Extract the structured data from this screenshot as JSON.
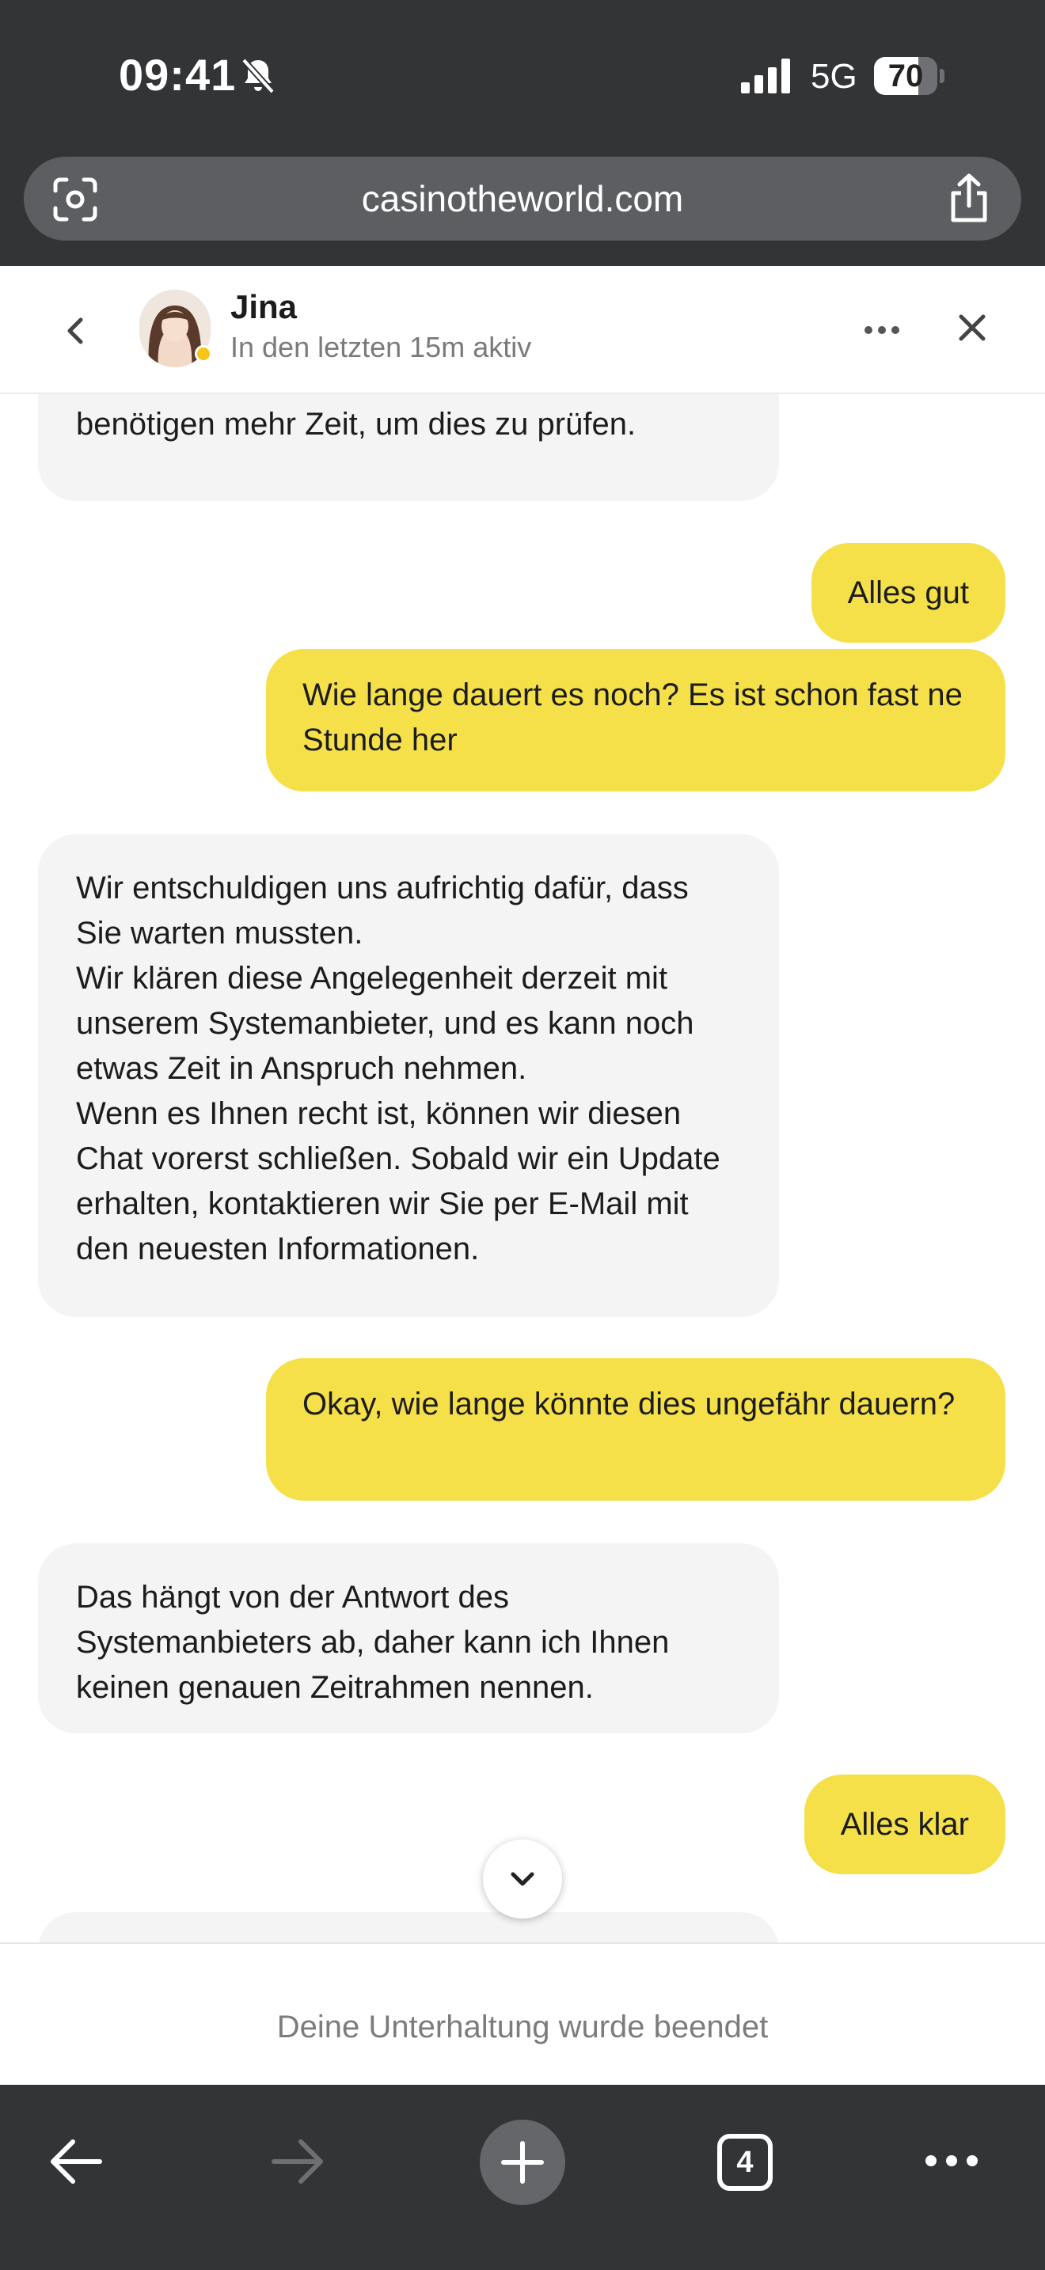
{
  "status_bar": {
    "time": "09:41",
    "network": "5G",
    "battery": "70",
    "battery_level": 0.7
  },
  "browser": {
    "url": "casinotheworld.com",
    "tab_count": "4"
  },
  "chat": {
    "agent_name": "Jina",
    "agent_status": "In den letzten 15m aktiv",
    "messages": [
      {
        "from": "agent",
        "text": "benötigen mehr Zeit, um dies zu prüfen."
      },
      {
        "from": "user",
        "text": "Alles gut"
      },
      {
        "from": "user",
        "text": "Wie lange dauert es noch? Es ist schon fast ne Stunde her"
      },
      {
        "from": "agent",
        "text": "Wir entschuldigen uns aufrichtig dafür, dass Sie warten mussten.\nWir klären diese Angelegenheit derzeit mit unserem Systemanbieter, und es kann noch etwas Zeit in Anspruch nehmen.\nWenn es Ihnen recht ist, können wir diesen Chat vorerst schließen. Sobald wir ein Update erhalten, kontaktieren wir Sie per E-Mail mit den neuesten Informationen."
      },
      {
        "from": "user",
        "text": "Okay, wie lange könnte dies ungefähr dauern?"
      },
      {
        "from": "agent",
        "text": "Das hängt von der Antwort des Systemanbieters ab, daher kann ich Ihnen keinen genauen Zeitrahmen nennen."
      },
      {
        "from": "user",
        "text": "Alles klar"
      }
    ],
    "ended_text": "Deine Unterhaltung wurde beendet"
  },
  "icons": {
    "status": [
      "bell-slash-icon",
      "signal-icon",
      "battery-icon"
    ],
    "browser": [
      "lens-icon",
      "share-icon",
      "back-arrow-icon",
      "forward-arrow-icon",
      "plus-icon",
      "tabs-icon",
      "more-icon"
    ],
    "chat": [
      "back-chevron-icon",
      "more-icon",
      "close-icon",
      "chevron-down-icon"
    ]
  },
  "colors": {
    "chrome": "#333436",
    "user_bubble": "#f5e04a",
    "agent_bubble": "#f4f4f4",
    "online_dot": "#f5c518"
  }
}
